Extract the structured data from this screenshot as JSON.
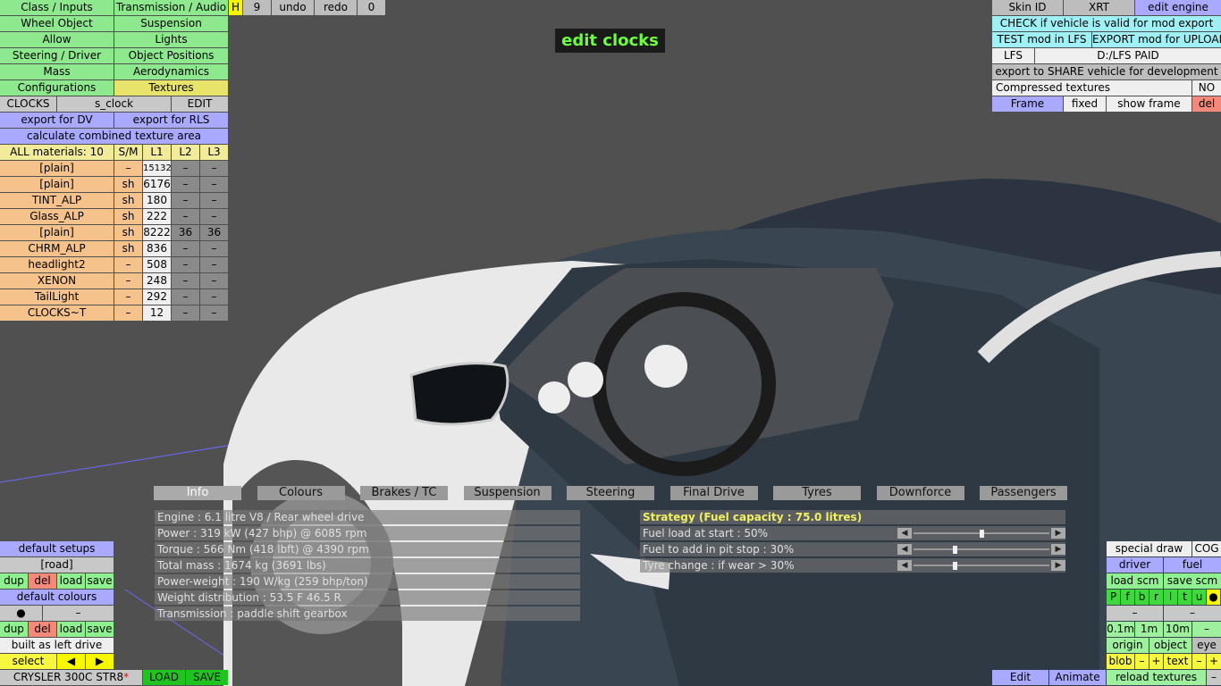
{
  "left_panel": {
    "row1": [
      "Class / Inputs",
      "Transmission / Audio",
      "H",
      "9",
      "undo",
      "redo",
      "0"
    ],
    "menu": [
      [
        "Wheel Object",
        "Suspension"
      ],
      [
        "Allow",
        "Lights"
      ],
      [
        "Steering / Driver",
        "Object Positions"
      ],
      [
        "Mass",
        "Aerodynamics"
      ],
      [
        "Configurations",
        "Textures"
      ]
    ],
    "clocks_row": [
      "CLOCKS",
      "s_clock",
      "EDIT"
    ],
    "export_dv": "export for DV",
    "export_rls": "export for RLS",
    "calc_texture": "calculate combined texture area",
    "materials_header": [
      "ALL materials: 10",
      "S/M",
      "L1",
      "L2",
      "L3"
    ],
    "materials": [
      {
        "name": "[plain]",
        "sm": "–",
        "l1": "15132",
        "l2": "–",
        "l3": "–"
      },
      {
        "name": "[plain]",
        "sm": "sh",
        "l1": "6176",
        "l2": "–",
        "l3": "–"
      },
      {
        "name": "TINT_ALP",
        "sm": "sh",
        "l1": "180",
        "l2": "–",
        "l3": "–"
      },
      {
        "name": "Glass_ALP",
        "sm": "sh",
        "l1": "222",
        "l2": "–",
        "l3": "–"
      },
      {
        "name": "[plain]",
        "sm": "sh",
        "l1": "8222",
        "l2": "36",
        "l3": "36"
      },
      {
        "name": "CHRM_ALP",
        "sm": "sh",
        "l1": "836",
        "l2": "–",
        "l3": "–"
      },
      {
        "name": "headlight2",
        "sm": "–",
        "l1": "508",
        "l2": "–",
        "l3": "–"
      },
      {
        "name": "XENON",
        "sm": "–",
        "l1": "248",
        "l2": "–",
        "l3": "–"
      },
      {
        "name": "TailLight",
        "sm": "–",
        "l1": "292",
        "l2": "–",
        "l3": "–"
      },
      {
        "name": "CLOCKS~T",
        "sm": "–",
        "l1": "12",
        "l2": "–",
        "l3": "–"
      }
    ]
  },
  "center_title": "edit clocks",
  "right_panel": {
    "skin_id": "Skin ID",
    "xrt": "XRT",
    "edit_engine": "edit engine",
    "check": "CHECK if vehicle is valid for mod export",
    "test_mod": "TEST mod in LFS",
    "export_upload": "EXPORT mod for UPLOAD",
    "lfs": "LFS",
    "lfs_path": "D:/LFS PAID",
    "export_share": "export to SHARE vehicle for development",
    "compressed": "Compressed textures",
    "compressed_val": "NO",
    "frame": "Frame",
    "fixed": "fixed",
    "show_frame": "show frame",
    "del": "del"
  },
  "tabs": [
    "Info",
    "Colours",
    "Brakes / TC",
    "Suspension",
    "Steering",
    "Final Drive",
    "Tyres",
    "Downforce",
    "Passengers"
  ],
  "info_lines": [
    "Engine : 6.1 litre V8 / Rear wheel drive",
    "Power : 319 kW (427 bhp) @ 6085 rpm",
    "Torque : 566 Nm (418 lbft) @ 4390 rpm",
    "Total mass : 1674 kg (3691 lbs)",
    "Power-weight : 190 W/kg (259 bhp/ton)",
    "Weight distribution : 53.5 F  46.5 R",
    "Transmission : paddle shift gearbox"
  ],
  "strategy": {
    "title": "Strategy (Fuel capacity : 75.0 litres)",
    "rows": [
      {
        "label": "Fuel load at start : 50%",
        "value": 0.5
      },
      {
        "label": "Fuel to add in pit stop : 30%",
        "value": 0.3
      },
      {
        "label": "Tyre change : if wear > 30%",
        "value": 0.3
      }
    ]
  },
  "bottom_left": {
    "default_setups": "default setups",
    "road": "[road]",
    "dup": "dup",
    "del": "del",
    "load": "load",
    "save": "save",
    "default_colours": "default colours",
    "dot": "●",
    "dash": "–",
    "built": "built as left drive",
    "select": "select",
    "prev": "◀",
    "next": "▶",
    "car": "CRYSLER 300C STR8",
    "star": "*",
    "LOAD": "LOAD",
    "SAVE": "SAVE"
  },
  "bottom_right": {
    "special_draw": "special draw",
    "cog": "COG",
    "driver": "driver",
    "fuel": "fuel",
    "load_scm": "load scm",
    "save_scm": "save scm",
    "letters": [
      "P",
      "f",
      "b",
      "r",
      "l",
      "t",
      "u",
      "●"
    ],
    "dash": "–",
    "scales": [
      "0.1m",
      "1m",
      "10m",
      "–"
    ],
    "origin": "origin",
    "object": "object",
    "eye": "eye",
    "blob": "blob",
    "minus": "–",
    "plus": "+",
    "text": "text",
    "edit": "Edit",
    "animate": "Animate",
    "reload": "reload textures"
  }
}
